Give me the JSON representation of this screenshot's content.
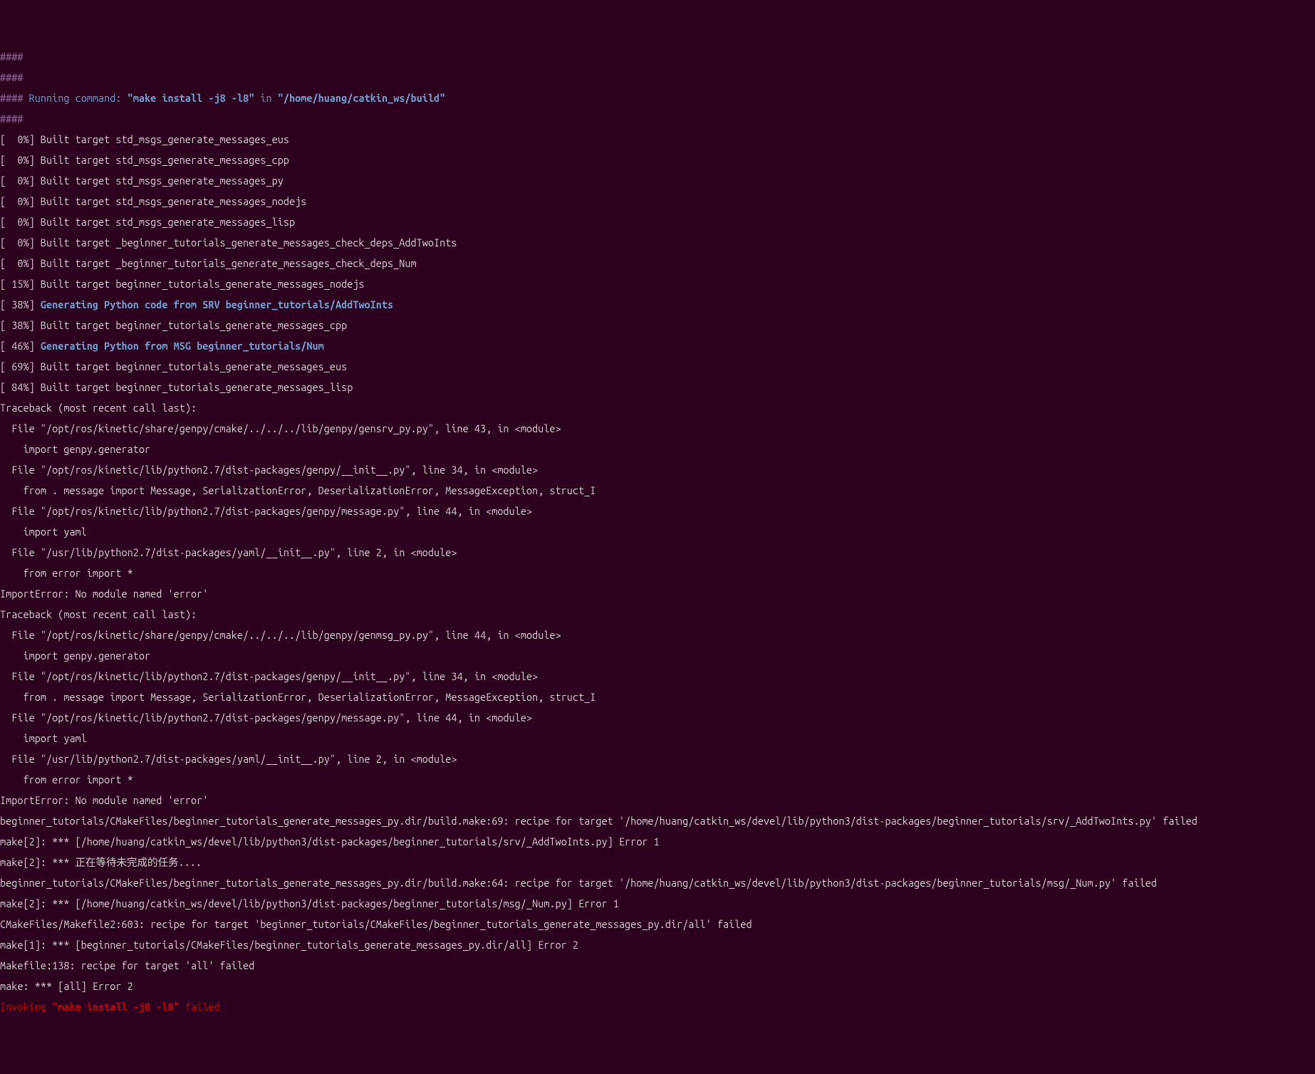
{
  "header": {
    "hash1": "####",
    "hash2": "####",
    "running_prefix": "#### ",
    "running_label": "Running command:",
    "running_cmd": "\"make install -j8 -l8\"",
    "running_in": "in",
    "running_path": "\"/home/huang/catkin_ws/build\"",
    "hash3": "####"
  },
  "targets": [
    "[  0%] Built target std_msgs_generate_messages_eus",
    "[  0%] Built target std_msgs_generate_messages_cpp",
    "[  0%] Built target std_msgs_generate_messages_py",
    "[  0%] Built target std_msgs_generate_messages_nodejs",
    "[  0%] Built target std_msgs_generate_messages_lisp",
    "[  0%] Built target _beginner_tutorials_generate_messages_check_deps_AddTwoInts",
    "[  0%] Built target _beginner_tutorials_generate_messages_check_deps_Num",
    "[ 15%] Built target beginner_tutorials_generate_messages_nodejs"
  ],
  "gen1": {
    "prefix": "[ 38%] ",
    "msg": "Generating Python code from SRV beginner_tutorials/AddTwoInts"
  },
  "built38": "[ 38%] Built target beginner_tutorials_generate_messages_cpp",
  "gen2": {
    "prefix": "[ 46%] ",
    "msg": "Generating Python from MSG beginner_tutorials/Num"
  },
  "built69": "[ 69%] Built target beginner_tutorials_generate_messages_eus",
  "built84": "[ 84%] Built target beginner_tutorials_generate_messages_lisp",
  "tb1": [
    "Traceback (most recent call last):",
    "  File \"/opt/ros/kinetic/share/genpy/cmake/../../../lib/genpy/gensrv_py.py\", line 43, in <module>",
    "    import genpy.generator",
    "  File \"/opt/ros/kinetic/lib/python2.7/dist-packages/genpy/__init__.py\", line 34, in <module>",
    "    from . message import Message, SerializationError, DeserializationError, MessageException, struct_I",
    "  File \"/opt/ros/kinetic/lib/python2.7/dist-packages/genpy/message.py\", line 44, in <module>",
    "    import yaml",
    "  File \"/usr/lib/python2.7/dist-packages/yaml/__init__.py\", line 2, in <module>",
    "    from error import *",
    "ImportError: No module named 'error'"
  ],
  "tb2": [
    "Traceback (most recent call last):",
    "  File \"/opt/ros/kinetic/share/genpy/cmake/../../../lib/genpy/genmsg_py.py\", line 44, in <module>",
    "    import genpy.generator",
    "  File \"/opt/ros/kinetic/lib/python2.7/dist-packages/genpy/__init__.py\", line 34, in <module>",
    "    from . message import Message, SerializationError, DeserializationError, MessageException, struct_I",
    "  File \"/opt/ros/kinetic/lib/python2.7/dist-packages/genpy/message.py\", line 44, in <module>",
    "    import yaml",
    "  File \"/usr/lib/python2.7/dist-packages/yaml/__init__.py\", line 2, in <module>",
    "    from error import *",
    "ImportError: No module named 'error'"
  ],
  "errors": [
    "beginner_tutorials/CMakeFiles/beginner_tutorials_generate_messages_py.dir/build.make:69: recipe for target '/home/huang/catkin_ws/devel/lib/python3/dist-packages/beginner_tutorials/srv/_AddTwoInts.py' failed",
    "make[2]: *** [/home/huang/catkin_ws/devel/lib/python3/dist-packages/beginner_tutorials/srv/_AddTwoInts.py] Error 1",
    "make[2]: *** 正在等待未完成的任务....",
    "beginner_tutorials/CMakeFiles/beginner_tutorials_generate_messages_py.dir/build.make:64: recipe for target '/home/huang/catkin_ws/devel/lib/python3/dist-packages/beginner_tutorials/msg/_Num.py' failed",
    "make[2]: *** [/home/huang/catkin_ws/devel/lib/python3/dist-packages/beginner_tutorials/msg/_Num.py] Error 1",
    "CMakeFiles/Makefile2:603: recipe for target 'beginner_tutorials/CMakeFiles/beginner_tutorials_generate_messages_py.dir/all' failed",
    "make[1]: *** [beginner_tutorials/CMakeFiles/beginner_tutorials_generate_messages_py.dir/all] Error 2",
    "Makefile:138: recipe for target 'all' failed",
    "make: *** [all] Error 2"
  ],
  "footer": {
    "invoking": "Invoking ",
    "cmd": "\"make install -j8 -l8\"",
    "failed": " failed"
  }
}
